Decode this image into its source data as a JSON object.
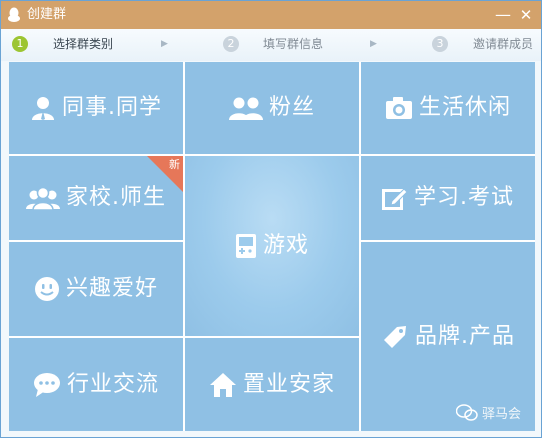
{
  "window": {
    "title": "创建群",
    "minimize_symbol": "—",
    "close_symbol": "✕"
  },
  "steps": [
    {
      "number": "1",
      "label": "选择群类别",
      "active": true
    },
    {
      "number": "2",
      "label": "填写群信息",
      "active": false
    },
    {
      "number": "3",
      "label": "邀请群成员",
      "active": false
    }
  ],
  "step_arrow": "▶",
  "categories": {
    "colleague_classmate": {
      "label": "同事.同学",
      "icon": "person-icon"
    },
    "fans": {
      "label": "粉丝",
      "icon": "two-persons-icon"
    },
    "life_leisure": {
      "label": "生活休闲",
      "icon": "camera-icon"
    },
    "school_teacher": {
      "label": "家校.师生",
      "icon": "group-icon",
      "badge": "新"
    },
    "game": {
      "label": "游戏",
      "icon": "gamepad-icon"
    },
    "study_exam": {
      "label": "学习.考试",
      "icon": "edit-icon"
    },
    "hobby": {
      "label": "兴趣爱好",
      "icon": "smiley-icon"
    },
    "brand_product": {
      "label": "品牌.产品",
      "icon": "tag-icon"
    },
    "industry_exchange": {
      "label": "行业交流",
      "icon": "chat-bubble-icon"
    },
    "real_estate": {
      "label": "置业安家",
      "icon": "home-icon"
    }
  },
  "watermark": {
    "text": "驿马会",
    "icon": "wechat-icon"
  },
  "colors": {
    "titlebar": "#d3a26b",
    "tile": "#8fc0e4",
    "tile_light": "#9ccbec",
    "badge": "#e67759",
    "step_active": "#9cc532"
  }
}
